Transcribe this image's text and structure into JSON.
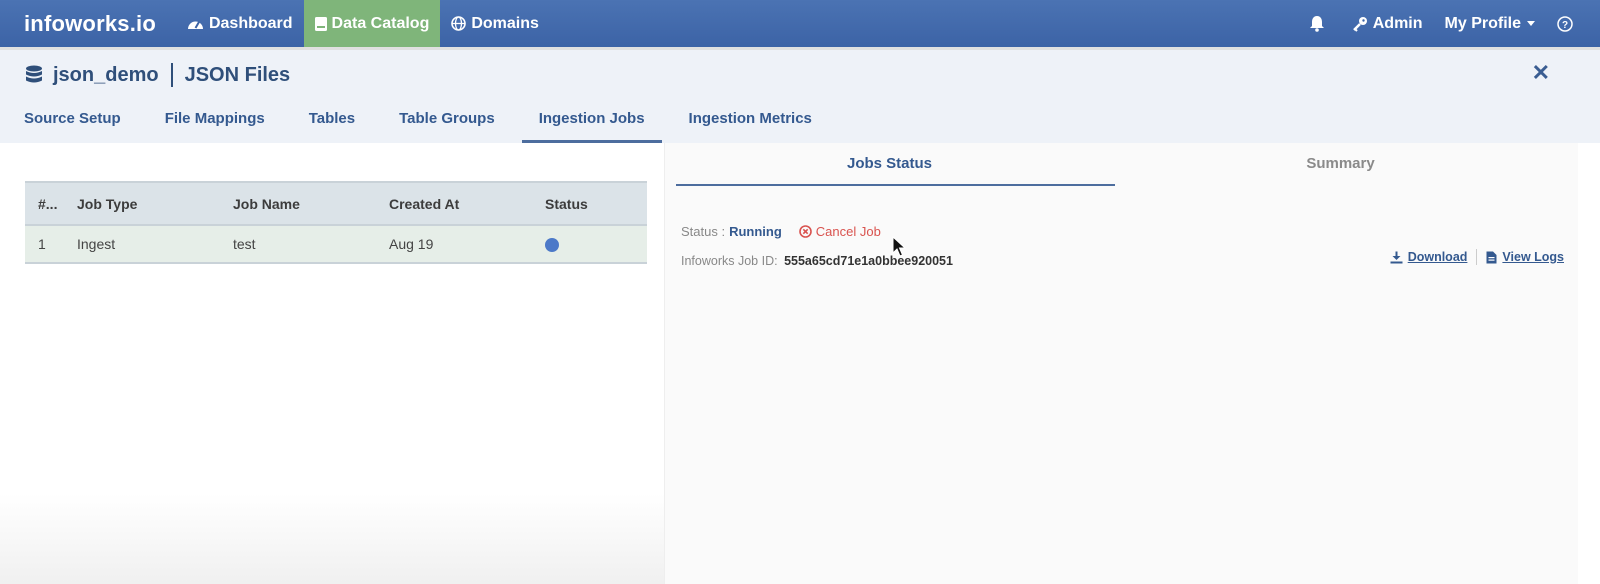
{
  "topnav": {
    "brand": "infoworks.io",
    "items": [
      {
        "label": "Dashboard",
        "icon": "dashboard-icon"
      },
      {
        "label": "Data Catalog",
        "icon": "catalog-icon",
        "active": true
      },
      {
        "label": "Domains",
        "icon": "globe-icon"
      }
    ],
    "right": {
      "bell_icon": "bell-icon",
      "admin_label": "Admin",
      "profile_label": "My Profile",
      "help_icon": "help-icon"
    },
    "colors": {
      "bar": "#3c63a6",
      "active": "#7fb57a"
    }
  },
  "header": {
    "source_name": "json_demo",
    "source_type": "JSON Files",
    "close_icon": "close-icon"
  },
  "tabs": [
    {
      "label": "Source Setup"
    },
    {
      "label": "File Mappings"
    },
    {
      "label": "Tables"
    },
    {
      "label": "Table Groups"
    },
    {
      "label": "Ingestion Jobs",
      "active": true
    },
    {
      "label": "Ingestion Metrics"
    }
  ],
  "jobs_table": {
    "columns": [
      "#...",
      "Job Type",
      "Job Name",
      "Created At",
      "Status"
    ],
    "rows": [
      {
        "num": "1",
        "job_type": "Ingest",
        "job_name": "test",
        "created_at": "Aug 19",
        "status": "running",
        "status_color": "#4c79c8"
      }
    ]
  },
  "detail": {
    "tabs": [
      {
        "label": "Jobs Status",
        "active": true
      },
      {
        "label": "Summary"
      }
    ],
    "status_label": "Status :",
    "status_value": "Running",
    "cancel_label": "Cancel Job",
    "job_id_label": "Infoworks Job ID:",
    "job_id_value": "555a65cd71e1a0bbee920051",
    "download_label": "Download",
    "view_logs_label": "View Logs"
  }
}
